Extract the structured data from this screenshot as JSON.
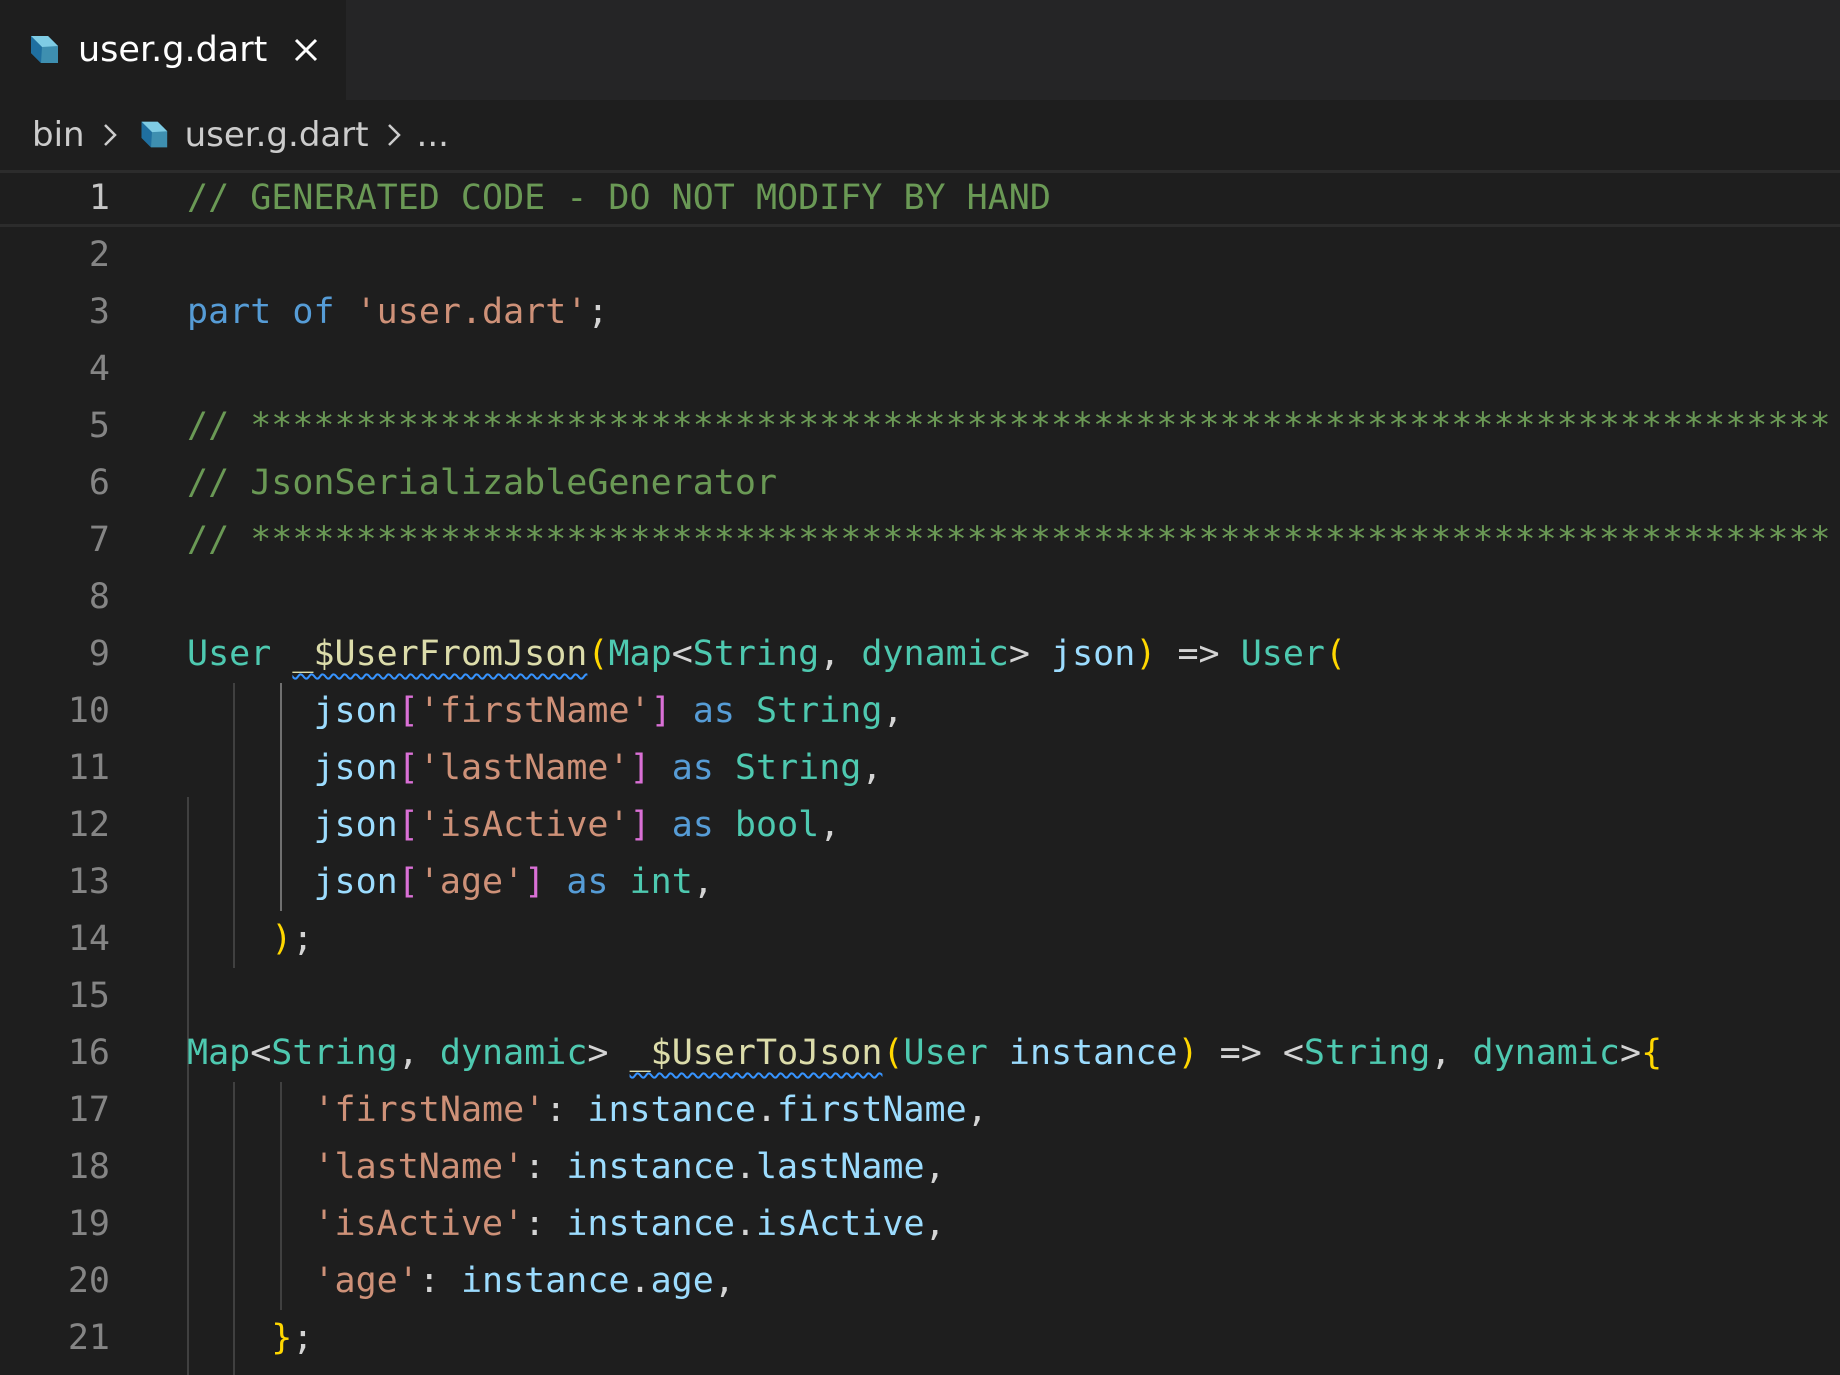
{
  "tab": {
    "label": "user.g.dart"
  },
  "breadcrumb": {
    "folder": "bin",
    "file": "user.g.dart",
    "more": "..."
  },
  "colors": {
    "background": "#1e1e1e",
    "comment": "#6a9955",
    "keyword": "#569cd6",
    "string": "#ce9178",
    "type": "#4ec9b0",
    "function": "#dcdcaa",
    "variable": "#9cdcfe",
    "bracket1": "#ffd700",
    "bracket2": "#da70d6",
    "squiggle": "#3794ff"
  },
  "editor": {
    "current_line": 1,
    "lines": [
      {
        "num": "1",
        "tokens": [
          [
            "cmt",
            "// GENERATED CODE - DO NOT MODIFY BY HAND"
          ]
        ]
      },
      {
        "num": "2",
        "tokens": []
      },
      {
        "num": "3",
        "tokens": [
          [
            "kw",
            "part"
          ],
          [
            "op",
            " "
          ],
          [
            "kw",
            "of"
          ],
          [
            "op",
            " "
          ],
          [
            "str",
            "'user.dart'"
          ],
          [
            "op",
            ";"
          ]
        ]
      },
      {
        "num": "4",
        "tokens": []
      },
      {
        "num": "5",
        "tokens": [
          [
            "cmt",
            "// ***************************************************************************"
          ]
        ]
      },
      {
        "num": "6",
        "tokens": [
          [
            "cmt",
            "// JsonSerializableGenerator"
          ]
        ]
      },
      {
        "num": "7",
        "tokens": [
          [
            "cmt",
            "// ***************************************************************************"
          ]
        ]
      },
      {
        "num": "8",
        "tokens": []
      },
      {
        "num": "9",
        "tokens": [
          [
            "type",
            "User"
          ],
          [
            "op",
            " "
          ],
          [
            "fn-sq",
            "_$UserFromJson"
          ],
          [
            "p1",
            "("
          ],
          [
            "type",
            "Map"
          ],
          [
            "op",
            "<"
          ],
          [
            "type",
            "String"
          ],
          [
            "op",
            ", "
          ],
          [
            "type",
            "dynamic"
          ],
          [
            "op",
            "> "
          ],
          [
            "var",
            "json"
          ],
          [
            "p1",
            ")"
          ],
          [
            "op",
            " => "
          ],
          [
            "type",
            "User"
          ],
          [
            "p1",
            "("
          ]
        ]
      },
      {
        "num": "10",
        "tokens": [
          [
            "op",
            "      "
          ],
          [
            "var",
            "json"
          ],
          [
            "p2",
            "["
          ],
          [
            "str",
            "'firstName'"
          ],
          [
            "p2",
            "]"
          ],
          [
            "op",
            " "
          ],
          [
            "kw",
            "as"
          ],
          [
            "op",
            " "
          ],
          [
            "type",
            "String"
          ],
          [
            "op",
            ","
          ]
        ]
      },
      {
        "num": "11",
        "tokens": [
          [
            "op",
            "      "
          ],
          [
            "var",
            "json"
          ],
          [
            "p2",
            "["
          ],
          [
            "str",
            "'lastName'"
          ],
          [
            "p2",
            "]"
          ],
          [
            "op",
            " "
          ],
          [
            "kw",
            "as"
          ],
          [
            "op",
            " "
          ],
          [
            "type",
            "String"
          ],
          [
            "op",
            ","
          ]
        ]
      },
      {
        "num": "12",
        "tokens": [
          [
            "op",
            "      "
          ],
          [
            "var",
            "json"
          ],
          [
            "p2",
            "["
          ],
          [
            "str",
            "'isActive'"
          ],
          [
            "p2",
            "]"
          ],
          [
            "op",
            " "
          ],
          [
            "kw",
            "as"
          ],
          [
            "op",
            " "
          ],
          [
            "type",
            "bool"
          ],
          [
            "op",
            ","
          ]
        ]
      },
      {
        "num": "13",
        "tokens": [
          [
            "op",
            "      "
          ],
          [
            "var",
            "json"
          ],
          [
            "p2",
            "["
          ],
          [
            "str",
            "'age'"
          ],
          [
            "p2",
            "]"
          ],
          [
            "op",
            " "
          ],
          [
            "kw",
            "as"
          ],
          [
            "op",
            " "
          ],
          [
            "type",
            "int"
          ],
          [
            "op",
            ","
          ]
        ]
      },
      {
        "num": "14",
        "tokens": [
          [
            "op",
            "    "
          ],
          [
            "p1",
            ")"
          ],
          [
            "op",
            ";"
          ]
        ]
      },
      {
        "num": "15",
        "tokens": []
      },
      {
        "num": "16",
        "tokens": [
          [
            "type",
            "Map"
          ],
          [
            "op",
            "<"
          ],
          [
            "type",
            "String"
          ],
          [
            "op",
            ", "
          ],
          [
            "type",
            "dynamic"
          ],
          [
            "op",
            "> "
          ],
          [
            "fn-sq",
            "_$UserToJson"
          ],
          [
            "p1",
            "("
          ],
          [
            "type",
            "User"
          ],
          [
            "op",
            " "
          ],
          [
            "var",
            "instance"
          ],
          [
            "p1",
            ")"
          ],
          [
            "op",
            " => <"
          ],
          [
            "type",
            "String"
          ],
          [
            "op",
            ", "
          ],
          [
            "type",
            "dynamic"
          ],
          [
            "op",
            ">"
          ],
          [
            "p1",
            "{"
          ]
        ]
      },
      {
        "num": "17",
        "tokens": [
          [
            "op",
            "      "
          ],
          [
            "str",
            "'firstName'"
          ],
          [
            "op",
            ": "
          ],
          [
            "var",
            "instance"
          ],
          [
            "op",
            "."
          ],
          [
            "var",
            "firstName"
          ],
          [
            "op",
            ","
          ]
        ]
      },
      {
        "num": "18",
        "tokens": [
          [
            "op",
            "      "
          ],
          [
            "str",
            "'lastName'"
          ],
          [
            "op",
            ": "
          ],
          [
            "var",
            "instance"
          ],
          [
            "op",
            "."
          ],
          [
            "var",
            "lastName"
          ],
          [
            "op",
            ","
          ]
        ]
      },
      {
        "num": "19",
        "tokens": [
          [
            "op",
            "      "
          ],
          [
            "str",
            "'isActive'"
          ],
          [
            "op",
            ": "
          ],
          [
            "var",
            "instance"
          ],
          [
            "op",
            "."
          ],
          [
            "var",
            "isActive"
          ],
          [
            "op",
            ","
          ]
        ]
      },
      {
        "num": "20",
        "tokens": [
          [
            "op",
            "      "
          ],
          [
            "str",
            "'age'"
          ],
          [
            "op",
            ": "
          ],
          [
            "var",
            "instance"
          ],
          [
            "op",
            "."
          ],
          [
            "var",
            "age"
          ],
          [
            "op",
            ","
          ]
        ]
      },
      {
        "num": "21",
        "tokens": [
          [
            "op",
            "    "
          ],
          [
            "p1",
            "}"
          ],
          [
            "op",
            ";"
          ]
        ]
      }
    ]
  }
}
